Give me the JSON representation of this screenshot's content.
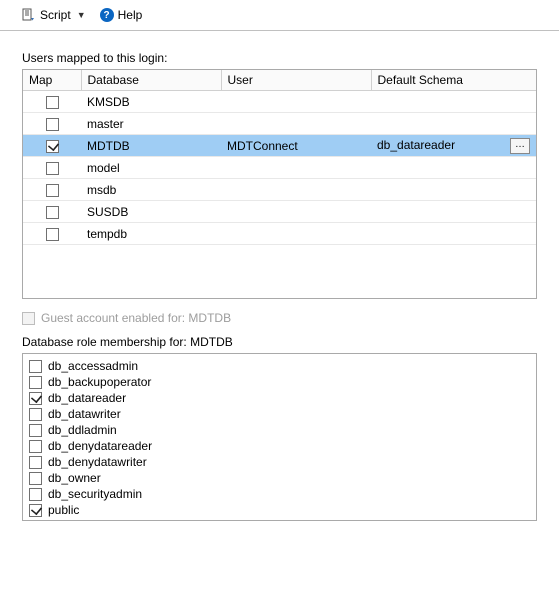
{
  "toolbar": {
    "script_label": "Script",
    "help_label": "Help"
  },
  "mappings": {
    "label": "Users mapped to this login:",
    "columns": {
      "map": "Map",
      "database": "Database",
      "user": "User",
      "schema": "Default Schema"
    },
    "rows": [
      {
        "mapped": false,
        "database": "KMSDB",
        "user": "",
        "schema": "",
        "selected": false
      },
      {
        "mapped": false,
        "database": "master",
        "user": "",
        "schema": "",
        "selected": false
      },
      {
        "mapped": true,
        "database": "MDTDB",
        "user": "MDTConnect",
        "schema": "db_datareader",
        "selected": true
      },
      {
        "mapped": false,
        "database": "model",
        "user": "",
        "schema": "",
        "selected": false
      },
      {
        "mapped": false,
        "database": "msdb",
        "user": "",
        "schema": "",
        "selected": false
      },
      {
        "mapped": false,
        "database": "SUSDB",
        "user": "",
        "schema": "",
        "selected": false
      },
      {
        "mapped": false,
        "database": "tempdb",
        "user": "",
        "schema": "",
        "selected": false
      }
    ]
  },
  "guest": {
    "label": "Guest account enabled for: MDTDB",
    "checked": false
  },
  "roles": {
    "label": "Database role membership for: MDTDB",
    "items": [
      {
        "name": "db_accessadmin",
        "checked": false
      },
      {
        "name": "db_backupoperator",
        "checked": false
      },
      {
        "name": "db_datareader",
        "checked": true
      },
      {
        "name": "db_datawriter",
        "checked": false
      },
      {
        "name": "db_ddladmin",
        "checked": false
      },
      {
        "name": "db_denydatareader",
        "checked": false
      },
      {
        "name": "db_denydatawriter",
        "checked": false
      },
      {
        "name": "db_owner",
        "checked": false
      },
      {
        "name": "db_securityadmin",
        "checked": false
      },
      {
        "name": "public",
        "checked": true
      }
    ]
  }
}
